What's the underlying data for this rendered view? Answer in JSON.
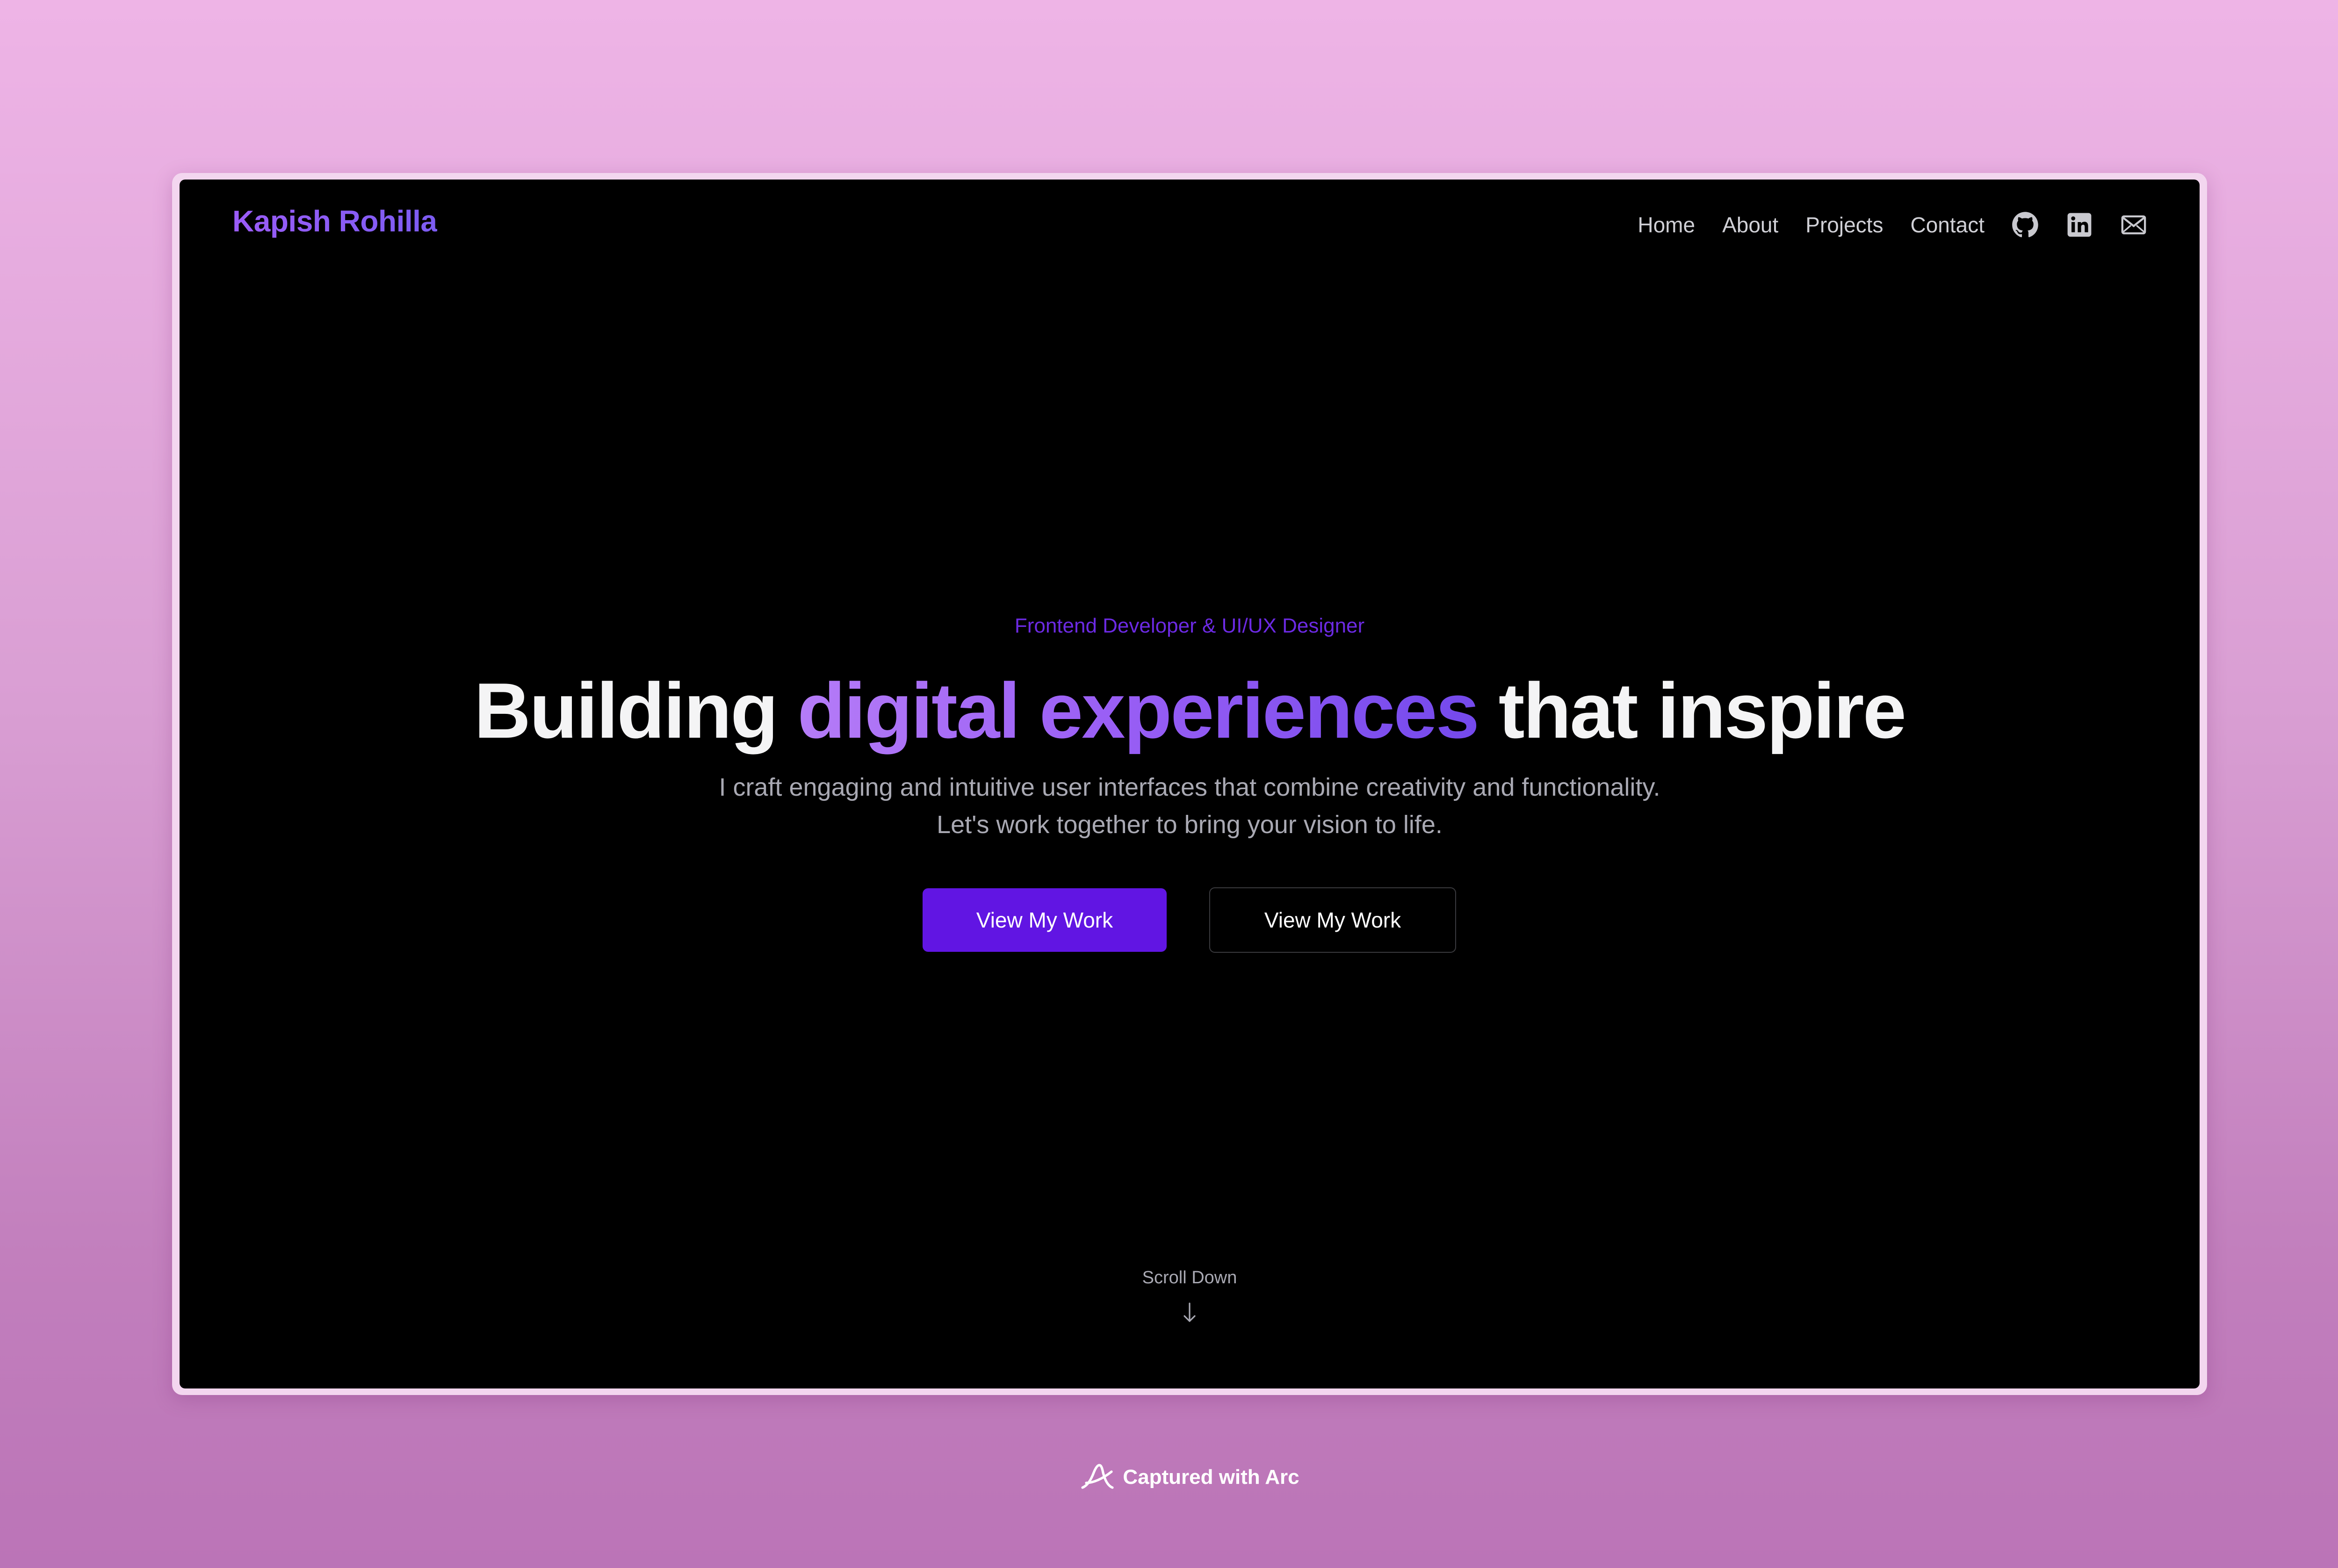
{
  "site": {
    "logo": "Kapish Rohilla"
  },
  "nav": {
    "items": [
      {
        "label": "Home"
      },
      {
        "label": "About"
      },
      {
        "label": "Projects"
      },
      {
        "label": "Contact"
      }
    ],
    "icons": [
      "github-icon",
      "linkedin-icon",
      "mail-icon"
    ]
  },
  "hero": {
    "subtitle": "Frontend Developer & UI/UX Designer",
    "headline_start": "Building ",
    "headline_accent": "digital experiences",
    "headline_end": " that inspire",
    "description_line1": "I craft engaging and intuitive user interfaces that combine creativity and functionality.",
    "description_line2": "Let's work together to bring your vision to life.",
    "primary_button": "View My Work",
    "secondary_button": "View My Work"
  },
  "scroll": {
    "label": "Scroll Down",
    "icon": "arrow-down-icon"
  },
  "capture": {
    "label": "Captured with Arc",
    "icon": "arc-logo-icon"
  },
  "colors": {
    "accent": "#6115e3",
    "gradient_start": "#b57cf7",
    "gradient_end": "#7449ec",
    "background": "#000000"
  }
}
